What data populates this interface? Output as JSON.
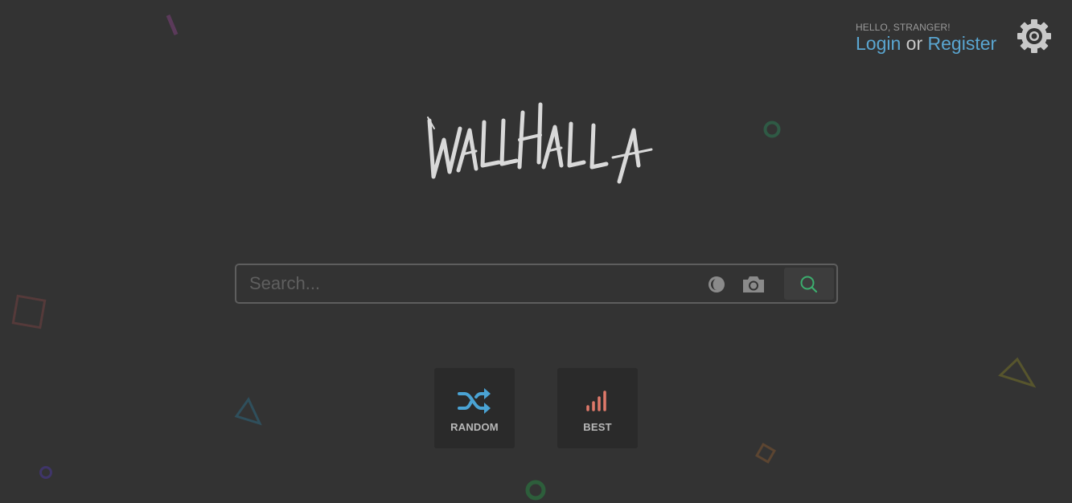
{
  "colors": {
    "background": "#333333",
    "link": "#5aa6d1",
    "random_accent": "#4aa3d4",
    "best_accent": "#e0796a",
    "search_accent": "#3cae6e"
  },
  "header": {
    "greeting": "HELLO, STRANGER!",
    "login_label": "Login",
    "or_label": "or",
    "register_label": "Register",
    "settings_icon": "gear-icon"
  },
  "logo": {
    "text": "WALLHALLA"
  },
  "search": {
    "value": "",
    "placeholder": "Search...",
    "contrast_icon": "contrast-icon",
    "camera_icon": "camera-icon",
    "submit_icon": "search-icon"
  },
  "quick_links": [
    {
      "label": "RANDOM",
      "icon": "shuffle-icon"
    },
    {
      "label": "BEST",
      "icon": "signal-bars-icon"
    }
  ]
}
